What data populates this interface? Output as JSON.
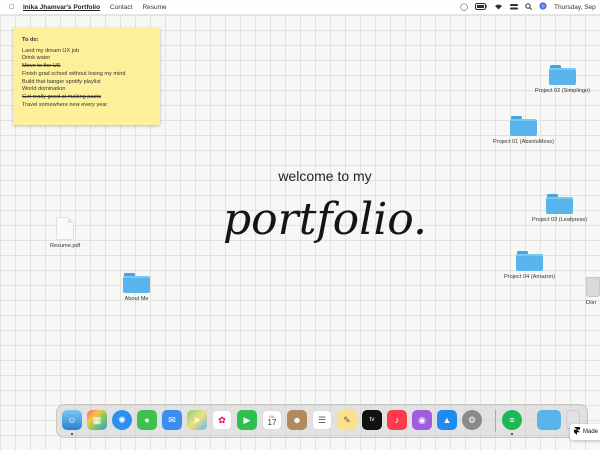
{
  "menubar": {
    "title": "Inika Jhamvar's Portfolio",
    "menus": [
      "Contact",
      "Resume"
    ],
    "clock": "Thursday, Sep"
  },
  "note": {
    "title": "To do:",
    "items": [
      {
        "text": "Land my dream UX job",
        "done": false
      },
      {
        "text": "Drink water",
        "done": false
      },
      {
        "text": "Move to the US",
        "done": true
      },
      {
        "text": "Finish grad school without losing my mind",
        "done": false
      },
      {
        "text": "Build that banger spotify playlist",
        "done": false
      },
      {
        "text": "World domination",
        "done": false
      },
      {
        "text": "Get really good at making pasta",
        "done": true
      },
      {
        "text": "Travel somewhere new every year",
        "done": false
      }
    ]
  },
  "hero": {
    "line1": "welcome to my",
    "line2": "portfolio."
  },
  "desktop": {
    "resume": "Resume.pdf",
    "about": "About Me",
    "project02": "Project 02 (Simplingo)",
    "project01": "Project 01 (AbsoluMess)",
    "project03": "Project 03 (Leafpress)",
    "project04": "Project 04 (Amazon)",
    "trash": "Don"
  },
  "dock": {
    "calendar_day": "17",
    "calendar_month": "JUL",
    "tv_label": "tv"
  },
  "badge": {
    "label": "Made"
  },
  "colors": {
    "folder": "#5ab4ec",
    "note": "#fdf09a",
    "grid": "#e2e2df"
  }
}
